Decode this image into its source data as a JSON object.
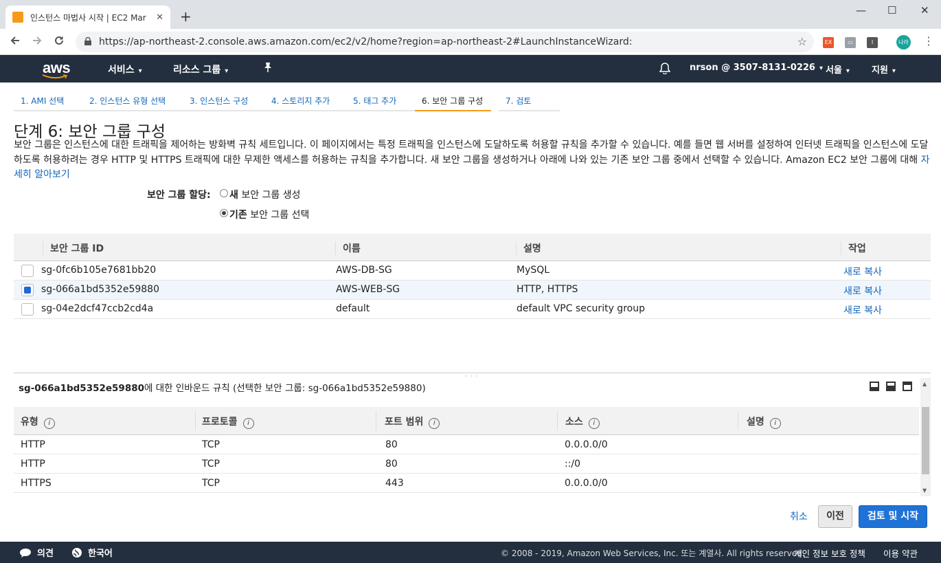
{
  "browser": {
    "tab_title": "인스턴스 마법사 시작 | EC2 Mar",
    "tab_close": "✕",
    "new_tab": "+",
    "window_controls": {
      "minimize": "—",
      "maximize": "☐",
      "close": "✕"
    },
    "url": "https://ap-northeast-2.console.aws.amazon.com/ec2/v2/home?region=ap-northeast-2#LaunchInstanceWizard:",
    "extensions": [
      {
        "label": "EX",
        "color": "#e8562a"
      },
      {
        "label": "▭",
        "color": "#9aa0a6"
      },
      {
        "label": "I",
        "color": "#555555"
      }
    ],
    "profile_label": "나라"
  },
  "aws_nav": {
    "logo": "aws",
    "services": "서비스",
    "resource_groups": "리소스 그룹",
    "account": "nrson @ 3507-8131-0226",
    "region": "서울",
    "support": "지원",
    "chevron": "⌄"
  },
  "steps": [
    {
      "label": "1. AMI 선택",
      "active": false
    },
    {
      "label": "2. 인스턴스 유형 선택",
      "active": false
    },
    {
      "label": "3. 인스턴스 구성",
      "active": false
    },
    {
      "label": "4. 스토리지 추가",
      "active": false
    },
    {
      "label": "5. 태그 추가",
      "active": false
    },
    {
      "label": "6. 보안 그룹 구성",
      "active": true
    },
    {
      "label": "7. 검토",
      "active": false
    }
  ],
  "page": {
    "title": "단계 6: 보안 그룹 구성",
    "description": "보안 그룹은 인스턴스에 대한 트래픽을 제어하는 방화벽 규칙 세트입니다. 이 페이지에서는 특정 트래픽을 인스턴스에 도달하도록 허용할 규칙을 추가할 수 있습니다. 예를 들면 웹 서버를 설정하여 인터넷 트래픽을 인스턴스에 도달하도록 허용하려는 경우 HTTP 및 HTTPS 트래픽에 대한 무제한 액세스를 허용하는 규칙을 추가합니다. 새 보안 그룹을 생성하거나 아래에 나와 있는 기존 보안 그룹 중에서 선택할 수 있습니다. Amazon EC2 보안 그룹에 대해 ",
    "learn_more": "자세히 알아보기",
    "assign_label": "보안 그룹 할당:",
    "radio_new_bold": "새",
    "radio_new_rest": " 보안 그룹 생성",
    "radio_existing_bold": "기존",
    "radio_existing_rest": " 보안 그룹 선택"
  },
  "sg_table": {
    "headers": [
      "보안 그룹 ID",
      "이름",
      "설명",
      "작업"
    ],
    "rows": [
      {
        "id": "sg-0fc6b105e7681bb20",
        "name": "AWS-DB-SG",
        "description": "MySQL",
        "action": "새로 복사",
        "selected": false
      },
      {
        "id": "sg-066a1bd5352e59880",
        "name": "AWS-WEB-SG",
        "description": "HTTP, HTTPS",
        "action": "새로 복사",
        "selected": true
      },
      {
        "id": "sg-04e2dcf47ccb2cd4a",
        "name": "default",
        "description": "default VPC security group",
        "action": "새로 복사",
        "selected": false
      }
    ]
  },
  "inbound": {
    "title_id": "sg-066a1bd5352e59880",
    "title_rest": "에 대한 인바운드 규칙 (선택한 보안 그룹: sg-066a1bd5352e59880)",
    "grip": "◦◦◦",
    "headers": [
      "유형",
      "프로토콜",
      "포트 범위",
      "소스",
      "설명"
    ],
    "info_glyph": "i",
    "rows": [
      {
        "type": "HTTP",
        "protocol": "TCP",
        "port": "80",
        "source": "0.0.0.0/0",
        "description": ""
      },
      {
        "type": "HTTP",
        "protocol": "TCP",
        "port": "80",
        "source": "::/0",
        "description": ""
      },
      {
        "type": "HTTPS",
        "protocol": "TCP",
        "port": "443",
        "source": "0.0.0.0/0",
        "description": ""
      }
    ]
  },
  "actions": {
    "cancel": "취소",
    "previous": "이전",
    "review_launch": "검토 및 시작"
  },
  "footer": {
    "feedback": "의견",
    "language": "한국어",
    "copyright": "© 2008 - 2019, Amazon Web Services, Inc. 또는 계열사. All rights reserved.",
    "privacy": "개인 정보 보호 정책",
    "terms": "이용 약관"
  },
  "colors": {
    "aws_nav_bg": "#232f3e",
    "link_blue": "#1166bb",
    "primary_button": "#1f72d6",
    "active_step_accent": "#f59b1b"
  }
}
